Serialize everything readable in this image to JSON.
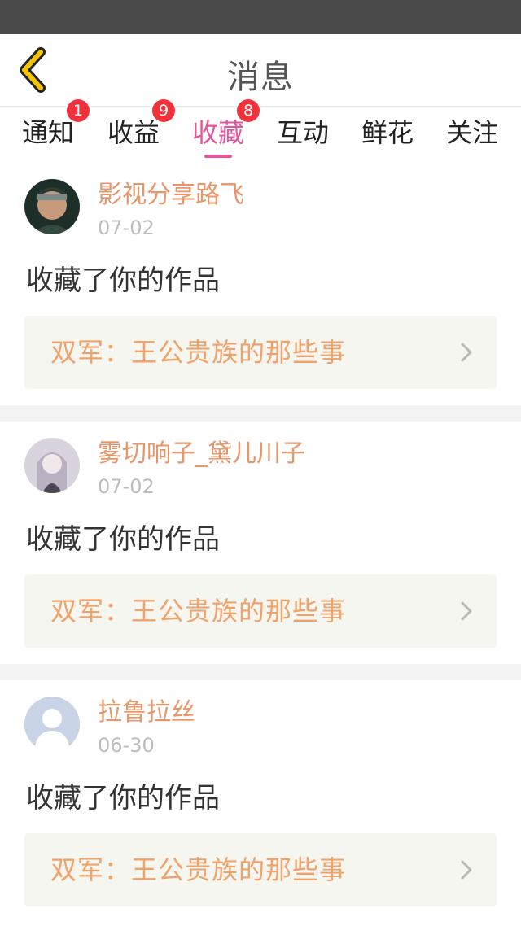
{
  "header": {
    "title": "消息"
  },
  "tabs": [
    {
      "label": "通知",
      "badge": "1",
      "active": false
    },
    {
      "label": "收益",
      "badge": "9",
      "active": false
    },
    {
      "label": "收藏",
      "badge": "8",
      "active": true
    },
    {
      "label": "互动",
      "badge": "",
      "active": false
    },
    {
      "label": "鲜花",
      "badge": "",
      "active": false
    },
    {
      "label": "关注",
      "badge": "",
      "active": false
    }
  ],
  "items": [
    {
      "user": "影视分享路飞",
      "date": "07-02",
      "action": "收藏了你的作品",
      "work": "双军：王公贵族的那些事"
    },
    {
      "user": "雾切响子_黛儿川子",
      "date": "07-02",
      "action": "收藏了你的作品",
      "work": "双军：王公贵族的那些事"
    },
    {
      "user": "拉鲁拉丝",
      "date": "06-30",
      "action": "收藏了你的作品",
      "work": "双军：王公贵族的那些事"
    }
  ],
  "colors": {
    "accent": "#e0579b",
    "badge": "#f0323c",
    "username": "#e9956a",
    "work_title": "#f0a26a"
  }
}
